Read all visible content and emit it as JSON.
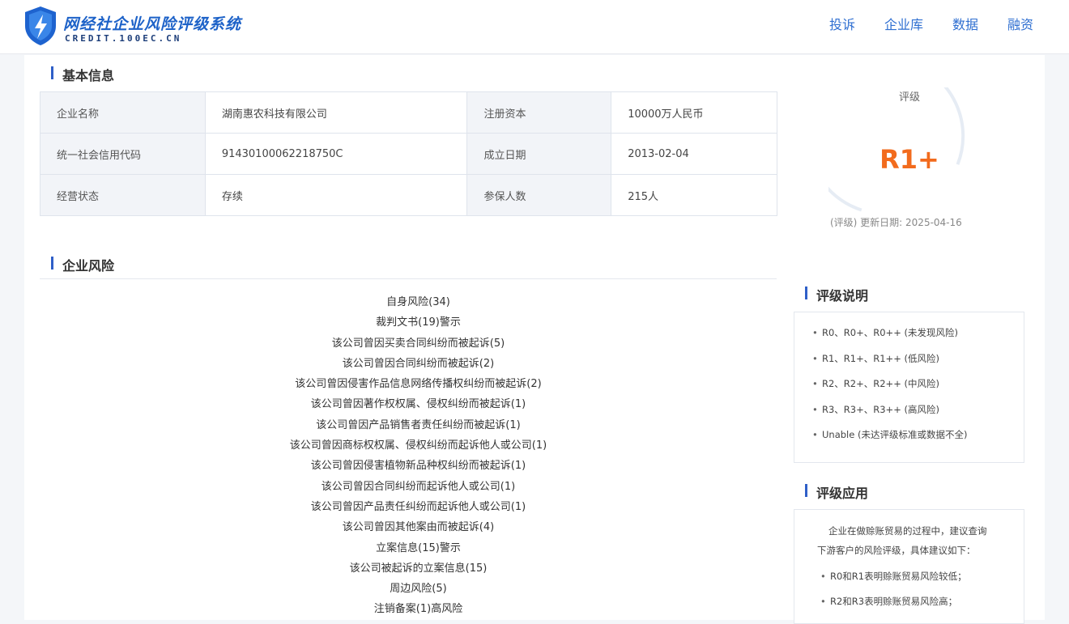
{
  "header": {
    "logo_title": "网经社企业风险评级系统",
    "logo_sub": "CREDIT.100EC.CN",
    "nav": [
      "投诉",
      "企业库",
      "数据",
      "融资"
    ]
  },
  "basic_info": {
    "title": "基本信息",
    "rows": [
      [
        {
          "label": "企业名称",
          "value": "湖南惠农科技有限公司"
        },
        {
          "label": "注册资本",
          "value": "10000万人民币"
        }
      ],
      [
        {
          "label": "统一社会信用代码",
          "value": "91430100062218750C"
        },
        {
          "label": "成立日期",
          "value": "2013-02-04"
        }
      ],
      [
        {
          "label": "经营状态",
          "value": "存续"
        },
        {
          "label": "参保人数",
          "value": "215人"
        }
      ]
    ]
  },
  "rating": {
    "label": "评级",
    "value": "R1+",
    "update_text": "(评级) 更新日期: 2025-04-16",
    "accent_color": "#f26b1d"
  },
  "risk": {
    "title": "企业风险",
    "items": [
      "自身风险(34)",
      "裁判文书(19)警示",
      "该公司曾因买卖合同纠纷而被起诉(5)",
      "该公司曾因合同纠纷而被起诉(2)",
      "该公司曾因侵害作品信息网络传播权纠纷而被起诉(2)",
      "该公司曾因著作权权属、侵权纠纷而被起诉(1)",
      "该公司曾因产品销售者责任纠纷而被起诉(1)",
      "该公司曾因商标权权属、侵权纠纷而起诉他人或公司(1)",
      "该公司曾因侵害植物新品种权纠纷而被起诉(1)",
      "该公司曾因合同纠纷而起诉他人或公司(1)",
      "该公司曾因产品责任纠纷而起诉他人或公司(1)",
      "该公司曾因其他案由而被起诉(4)",
      "立案信息(15)警示",
      "该公司被起诉的立案信息(15)",
      "周边风险(5)",
      "注销备案(1)高风险"
    ]
  },
  "rating_note": {
    "title": "评级说明",
    "items": [
      "R0、R0+、R0++ (未发现风险)",
      "R1、R1+、R1++ (低风险)",
      "R2、R2+、R2++ (中风险)",
      "R3、R3+、R3++ (高风险)",
      "Unable (未达评级标准或数据不全)"
    ]
  },
  "rating_app": {
    "title": "评级应用",
    "intro_1": "企业在做赊账贸易的过程中，建议查询",
    "intro_2": "下游客户的风险评级，具体建议如下：",
    "items": [
      "R0和R1表明赊账贸易风险较低；",
      "R2和R3表明赊账贸易风险高；"
    ]
  }
}
